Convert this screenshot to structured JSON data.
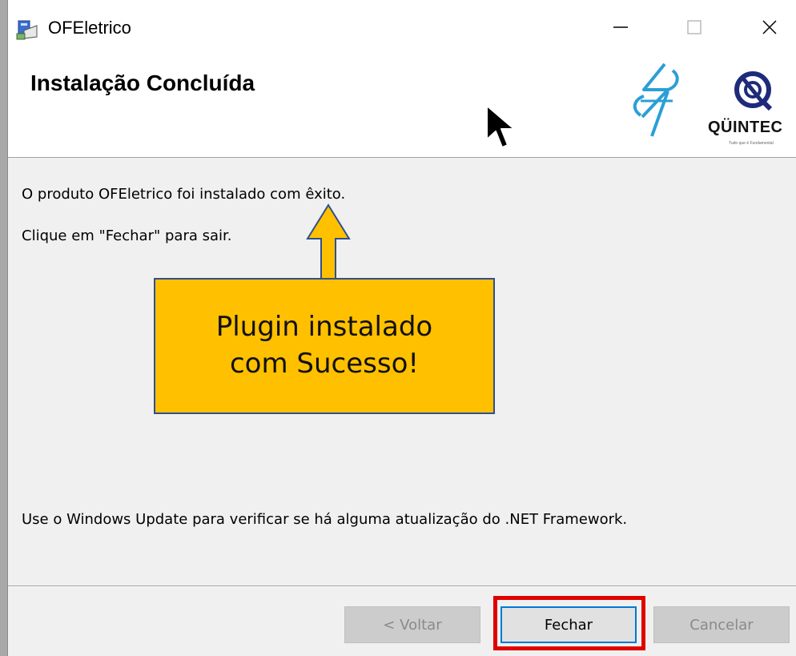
{
  "window": {
    "title": "OFEletrico",
    "controls": {
      "minimize": "minimize-icon",
      "maximize": "maximize-icon",
      "close": "close-icon"
    }
  },
  "header": {
    "title": "Instalação Concluída",
    "logos": [
      {
        "name": "s-bolt-logo"
      },
      {
        "name": "quintec-logo",
        "text": "QÜINTEC",
        "tagline": "Tudo que é Fundamental"
      }
    ]
  },
  "body": {
    "line1": "O produto OFEletrico foi instalado com êxito.",
    "line2": "Clique em \"Fechar\" para sair.",
    "line3": "Use o Windows Update para verificar se há alguma atualização do .NET Framework."
  },
  "callout": {
    "line1": "Plugin instalado",
    "line2": "com Sucesso!",
    "color": "#ffc000"
  },
  "footer": {
    "back_label": "< Voltar",
    "close_label": "Fechar",
    "cancel_label": "Cancelar"
  },
  "colors": {
    "highlight": "#e00000",
    "focus": "#0078d7"
  }
}
